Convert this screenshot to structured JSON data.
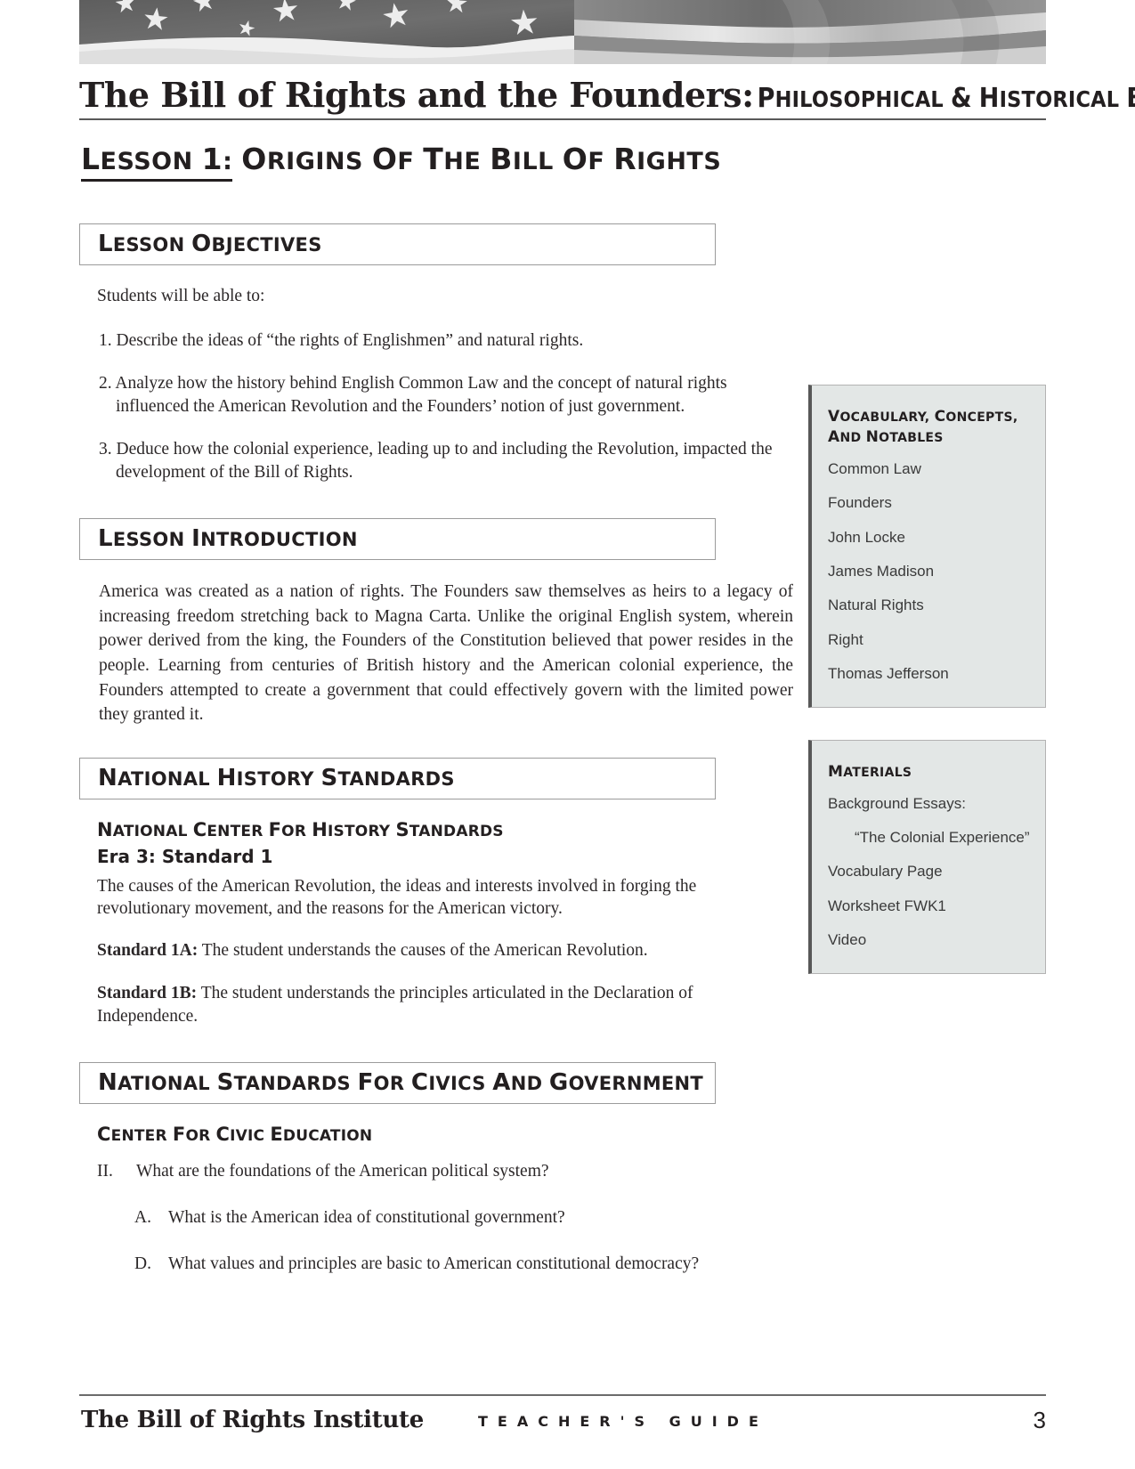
{
  "banner": {
    "alt": "american-flag-banner"
  },
  "header": {
    "title_blackletter": "The Bill of Rights and the Founders:",
    "title_subtitle": "Philosophical & Historical Background",
    "lesson_label": "Lesson 1:",
    "lesson_title": "Origins of the Bill of Rights"
  },
  "sections": {
    "objectives": {
      "heading": "Lesson Objectives",
      "lead": "Students will be able to:",
      "items": [
        "1. Describe the ideas of “the rights of Englishmen” and natural rights.",
        "2. Analyze how the history behind English Common Law and the concept of natural rights influenced the American Revolution and the Founders’ notion of just government.",
        "3. Deduce how the colonial experience, leading up to and including the Revolution, impacted the development of the Bill of Rights."
      ]
    },
    "introduction": {
      "heading": "Lesson Introduction",
      "body": "America was created as a nation of rights. The Founders saw themselves as heirs to a legacy of increasing freedom stretching back to Magna Carta. Unlike the original English system, wherein power derived from the king, the Founders of the Constitution believed that power resides in the people.  Learning from centuries of British history and the American colonial experience, the Founders attempted to create a government that could effectively govern with the limited power they granted it."
    },
    "history_standards": {
      "heading": "National History Standards",
      "organization": "National Center for History Standards",
      "era": "Era 3: Standard 1",
      "description": "The causes of the American Revolution, the ideas and interests involved in forging the revolutionary movement, and the reasons for the American victory.",
      "standard_1a_label": "Standard 1A:",
      "standard_1a_text": "The student understands the causes of the American Revolution.",
      "standard_1b_label": "Standard 1B:",
      "standard_1b_text": "The student understands the principles articulated in the Declaration of Independence."
    },
    "civics_standards": {
      "heading": "National Standards for Civics and Government",
      "organization": "Center for Civic Education",
      "items": [
        {
          "marker": "II.",
          "text": "What are the foundations of the American political system?",
          "level": 0
        },
        {
          "marker": "A.",
          "text": "What is the American idea of constitutional government?",
          "level": 1
        },
        {
          "marker": "D.",
          "text": "What values and principles are basic to American constitutional democracy?",
          "level": 1
        }
      ]
    }
  },
  "sidebar": {
    "vocabulary": {
      "title": "Vocabulary, Concepts, and Notables",
      "items": [
        "Common Law",
        "Founders",
        "John Locke",
        "James Madison",
        "Natural Rights",
        "Right",
        "Thomas Jefferson"
      ]
    },
    "materials": {
      "title": "Materials",
      "items": [
        {
          "text": "Background Essays:",
          "indent": false
        },
        {
          "text": "“The Colonial Experience”",
          "indent": true
        },
        {
          "text": "Vocabulary Page",
          "indent": false
        },
        {
          "text": "Worksheet FWK1",
          "indent": false
        },
        {
          "text": "Video",
          "indent": false
        }
      ]
    }
  },
  "footer": {
    "institute": "The Bill of Rights Institute",
    "guide_label": "TEACHER'S GUIDE",
    "page_number": "3"
  },
  "colors": {
    "text": "#231f20",
    "sidebar_fill": "#e3e7e6",
    "sidebar_accent": "#585858",
    "rule": "#6b6b6b",
    "box_border": "#9b9b9b"
  }
}
